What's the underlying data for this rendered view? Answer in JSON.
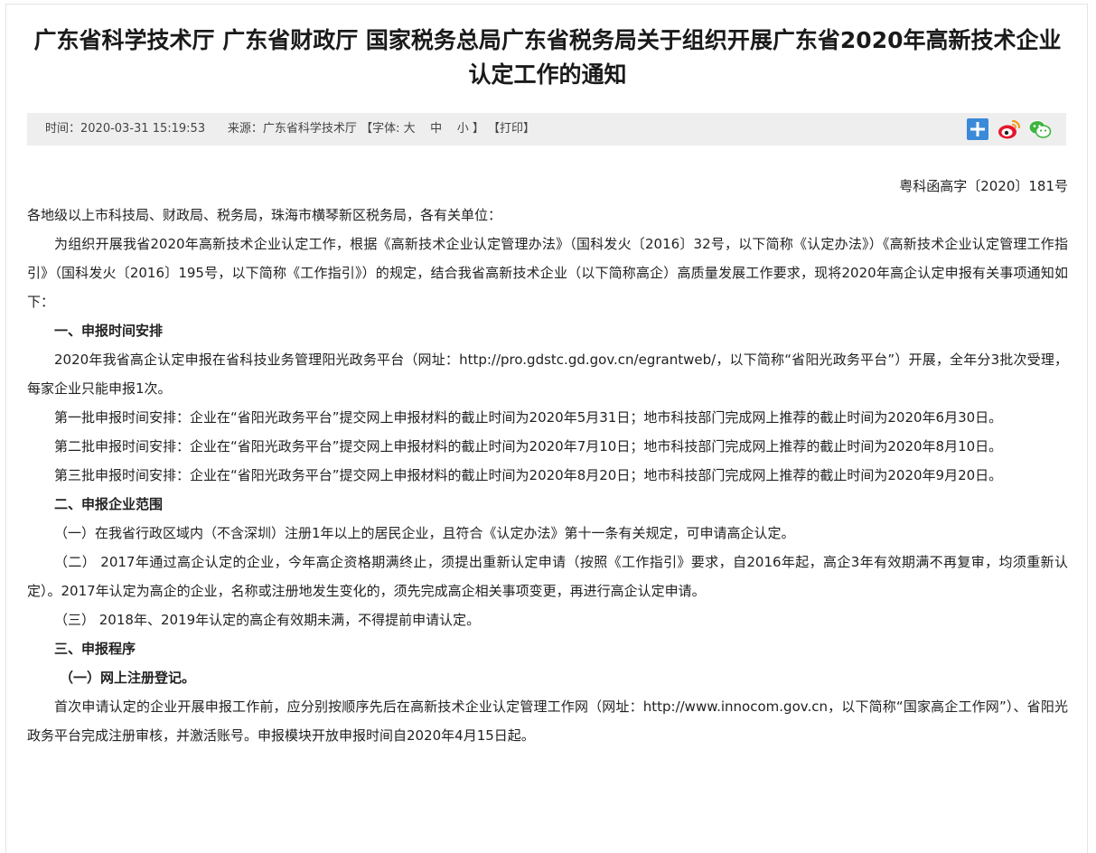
{
  "article": {
    "title": "广东省科学技术厅 广东省财政厅 国家税务总局广东省税务局关于组织开展广东省2020年高新技术企业认定工作的通知"
  },
  "meta": {
    "time_label": "时间：",
    "time_value": "2020-03-31 15:19:53",
    "source_label": "来源：",
    "source_value": "广东省科学技术厅",
    "font_open": "【字体:",
    "font_large": "大",
    "font_medium": "中",
    "font_small": "小",
    "font_close": "】",
    "print": "【打印】"
  },
  "share": {
    "icons": [
      "plus-share-icon",
      "weibo-icon",
      "wechat-icon"
    ],
    "colors": {
      "plus": "#3b8ad9",
      "weibo": "#e6162d",
      "wechat": "#3fb53f"
    }
  },
  "body": {
    "doc_number": "粤科函高字〔2020〕181号",
    "salutation": "各地级以上市科技局、财政局、税务局，珠海市横琴新区税务局，各有关单位：",
    "intro": "为组织开展我省2020年高新技术企业认定工作，根据《高新技术企业认定管理办法》（国科发火〔2016〕32号，以下简称《认定办法》）《高新技术企业认定管理工作指引》（国科发火〔2016〕195号，以下简称《工作指引》）的规定，结合我省高新技术企业（以下简称高企）高质量发展工作要求，现将2020年高企认定申报有关事项通知如下：",
    "section1_title": "一、申报时间安排",
    "section1_p1": "2020年我省高企认定申报在省科技业务管理阳光政务平台（网址：http://pro.gdstc.gd.gov.cn/egrantweb/，以下简称“省阳光政务平台”）开展，全年分3批次受理，每家企业只能申报1次。",
    "section1_p2": "第一批申报时间安排：企业在“省阳光政务平台”提交网上申报材料的截止时间为2020年5月31日；地市科技部门完成网上推荐的截止时间为2020年6月30日。",
    "section1_p3": "第二批申报时间安排：企业在“省阳光政务平台”提交网上申报材料的截止时间为2020年7月10日；地市科技部门完成网上推荐的截止时间为2020年8月10日。",
    "section1_p4": "第三批申报时间安排：企业在“省阳光政务平台”提交网上申报材料的截止时间为2020年8月20日；地市科技部门完成网上推荐的截止时间为2020年9月20日。",
    "section2_title": "二、申报企业范围",
    "section2_p1": "（一）在我省行政区域内（不含深圳）注册1年以上的居民企业，且符合《认定办法》第十一条有关规定，可申请高企认定。",
    "section2_p2": "（二） 2017年通过高企认定的企业，今年高企资格期满终止，须提出重新认定申请（按照《工作指引》要求，自2016年起，高企3年有效期满不再复审，均须重新认定）。2017年认定为高企的企业，名称或注册地发生变化的，须先完成高企相关事项变更，再进行高企认定申请。",
    "section2_p3": "（三） 2018年、2019年认定的高企有效期未满，不得提前申请认定。",
    "section3_title": "三、申报程序",
    "section3_sub1": "（一）网上注册登记。",
    "section3_p1": "首次申请认定的企业开展申报工作前，应分别按顺序先后在高新技术企业认定管理工作网（网址：http://www.innocom.gov.cn，以下简称“国家高企工作网”）、省阳光政务平台完成注册审核，并激活账号。申报模块开放申报时间自2020年4月15日起。"
  }
}
